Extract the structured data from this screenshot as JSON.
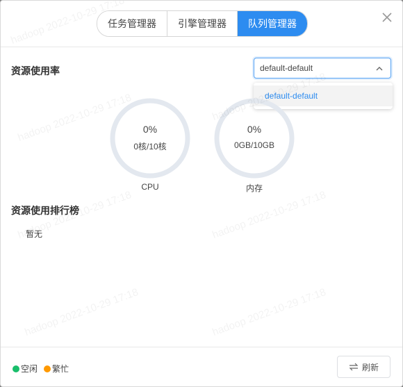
{
  "tabs": [
    {
      "label": "任务管理器",
      "active": false
    },
    {
      "label": "引擎管理器",
      "active": false
    },
    {
      "label": "队列管理器",
      "active": true
    }
  ],
  "close_icon": "close-icon",
  "usage": {
    "title": "资源使用率",
    "queue_select": {
      "value": "default-default",
      "options": [
        "default-default"
      ]
    },
    "cpu": {
      "percent_text": "0%",
      "detail": "0核/10核",
      "caption": "CPU",
      "fraction": 0
    },
    "memory": {
      "percent_text": "0%",
      "detail": "0GB/10GB",
      "caption": "内存",
      "fraction": 0
    }
  },
  "ranking": {
    "title": "资源使用排行榜",
    "empty_text": "暂无"
  },
  "legend": [
    {
      "label": "空闲",
      "color": "#19be6b"
    },
    {
      "label": "繁忙",
      "color": "#ff9900"
    }
  ],
  "refresh_label": "刷新",
  "watermark": "hadoop 2022-10-29 17:18",
  "colors": {
    "accent": "#2d8cf0",
    "ring_track": "#e3e8ef"
  }
}
